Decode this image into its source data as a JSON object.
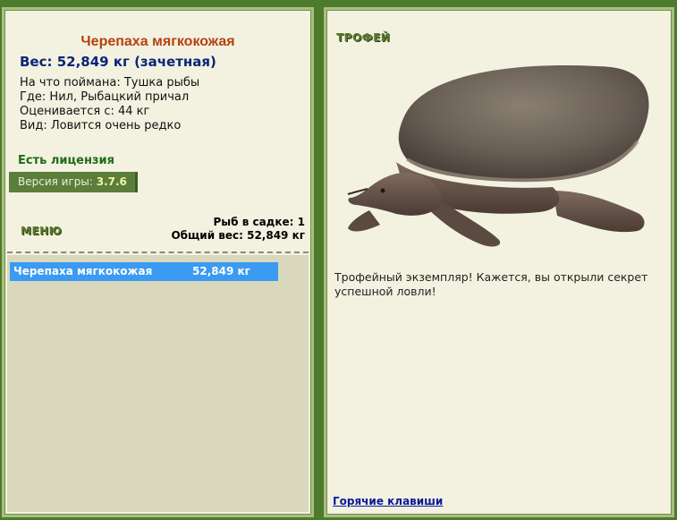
{
  "fish": {
    "title": "Черепаха мягкокожая",
    "weight": "Вес: 52,849 кг (зачетная)",
    "bait": "На что поймана: Тушка рыбы",
    "where": "Где: Нил, Рыбацкий причал",
    "value": "Оценивается с: 44 кг",
    "rarity": "Вид: Ловится очень редко"
  },
  "license": "Есть лицензия",
  "version": {
    "label": "Версия игры:",
    "number": "3.7.6"
  },
  "menu_label": "МЕНЮ",
  "stats": {
    "count": "Рыб в садке: 1",
    "total": "Общий вес: 52,849 кг"
  },
  "catch_list": [
    {
      "name": "Черепаха мягкокожая",
      "weight": "52,849 кг"
    }
  ],
  "trophy": {
    "label": "ТРОФЕЙ",
    "text": "Трофейный экземпляр! Кажется, вы открыли секрет успешной ловли!"
  },
  "hotkeys": "Горячие клавиши",
  "colors": {
    "background": "#4e7a2e",
    "panel": "#f3f2e1",
    "title": "#b5410f",
    "selected_row": "#3b9bf2"
  }
}
